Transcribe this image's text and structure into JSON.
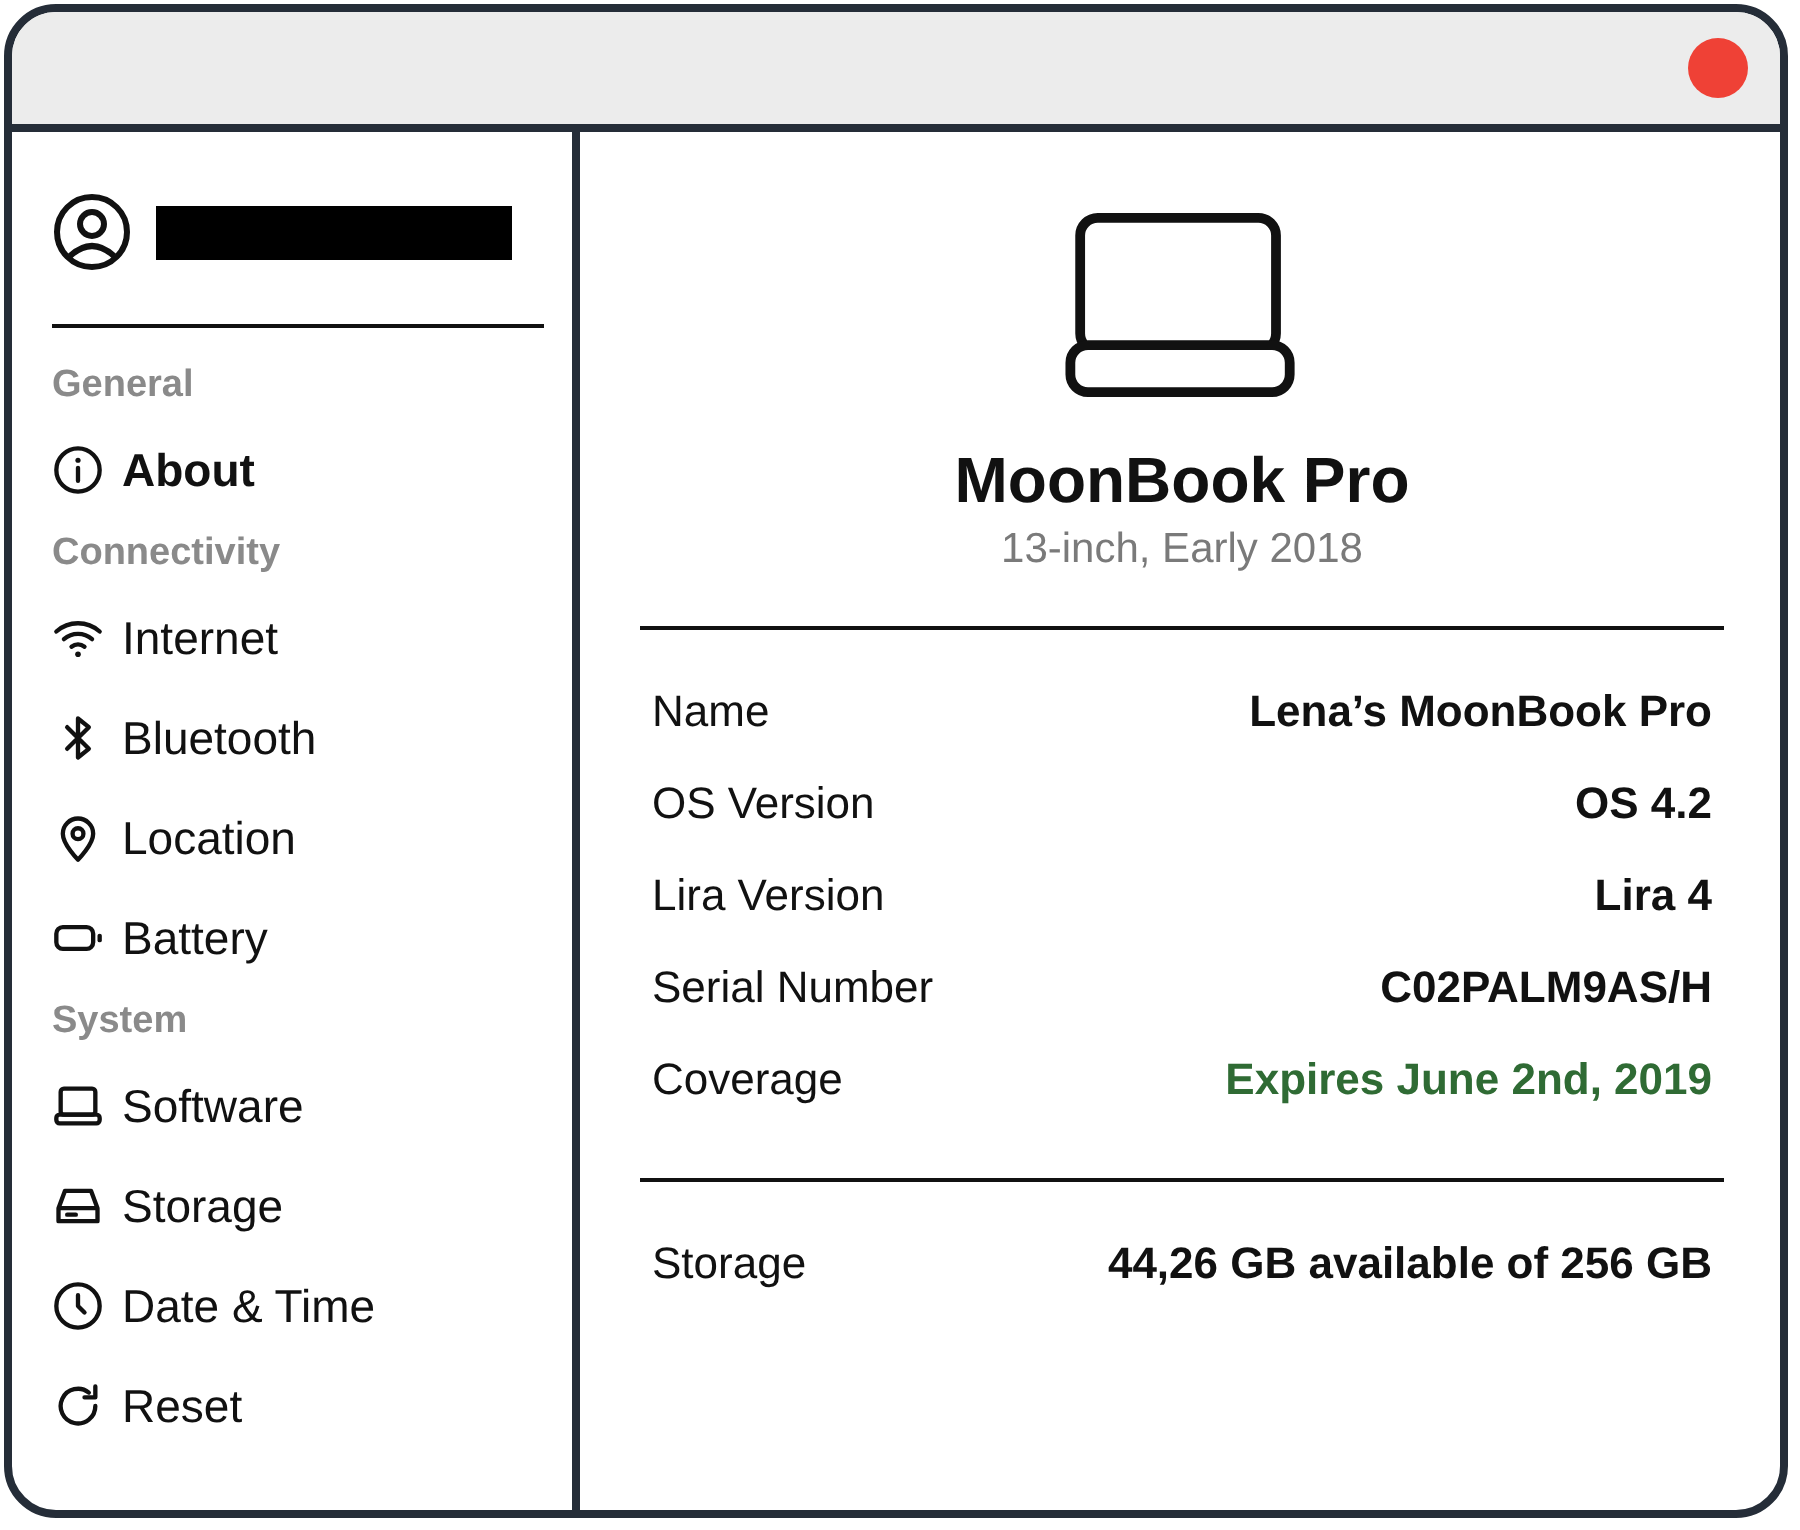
{
  "window": {
    "close_button": true
  },
  "sidebar": {
    "sections": [
      {
        "title": "General",
        "items": [
          {
            "label": "About",
            "selected": true
          }
        ]
      },
      {
        "title": "Connectivity",
        "items": [
          {
            "label": "Internet",
            "selected": false
          },
          {
            "label": "Bluetooth",
            "selected": false
          },
          {
            "label": "Location",
            "selected": false
          },
          {
            "label": "Battery",
            "selected": false
          }
        ]
      },
      {
        "title": "System",
        "items": [
          {
            "label": "Software",
            "selected": false
          },
          {
            "label": "Storage",
            "selected": false
          },
          {
            "label": "Date & Time",
            "selected": false
          },
          {
            "label": "Reset",
            "selected": false
          }
        ]
      }
    ]
  },
  "device": {
    "name": "MoonBook Pro",
    "subtitle": "13-inch, Early 2018"
  },
  "details": [
    {
      "label": "Name",
      "value": "Lena’s MoonBook Pro",
      "color": "#111111"
    },
    {
      "label": "OS Version",
      "value": "OS 4.2",
      "color": "#111111"
    },
    {
      "label": "Lira Version",
      "value": "Lira 4",
      "color": "#111111"
    },
    {
      "label": "Serial Number",
      "value": "C02PALM9AS/H",
      "color": "#111111"
    },
    {
      "label": "Coverage",
      "value": "Expires June 2nd, 2019",
      "color": "#2f6b34"
    }
  ],
  "storage": [
    {
      "label": "Storage",
      "value": "44,26 GB available of 256 GB",
      "color": "#111111"
    }
  ]
}
